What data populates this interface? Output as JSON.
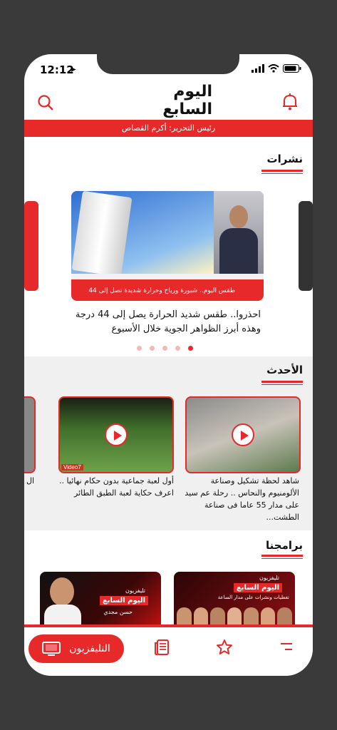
{
  "status_bar": {
    "time": "12:12"
  },
  "header": {
    "logo_text": "اليوم السابع",
    "editor_line": "رئيس التحرير: أكرم القصاص"
  },
  "sections": {
    "bulletins": {
      "title": "نشرات"
    },
    "latest": {
      "title": "الأحدث"
    },
    "programs": {
      "title": "برامجنا"
    }
  },
  "hero": {
    "image_caption": "طقس اليوم.. شبورة ورياح وحرارة شديدة تصل إلى 44 درجة",
    "headline": "احذروا.. طقس شديد الحرارة يصل إلى 44 درجة وهذه أبرز الظواهر الجوية خلال الأسبوع"
  },
  "videos": [
    {
      "text": "شاهد لحظة تشكيل وصناعة الألومنيوم والنحاس .. رحلة عم سيد على مدار 55 عاما فى صناعة الطشت..."
    },
    {
      "text": "أول لعبة جماعية بدون حكام نهائيا .. اعرف حكاية لعبة الطبق الطائر"
    },
    {
      "text": "ال الش لحم"
    }
  ],
  "video_badge": "Video7",
  "programs": [
    {
      "brand_small": "تليفزيون",
      "brand": "اليوم السابع",
      "subtitle": "تغطيات ونشرات على مدار الساعة"
    },
    {
      "brand_small": "تليفزيون",
      "brand": "اليوم السابع",
      "subtitle": "حسن مجدي"
    }
  ],
  "bottom_nav": {
    "tv_label": "التليفزيون"
  },
  "colors": {
    "accent": "#e7292a",
    "background": "#3a3a3a"
  }
}
